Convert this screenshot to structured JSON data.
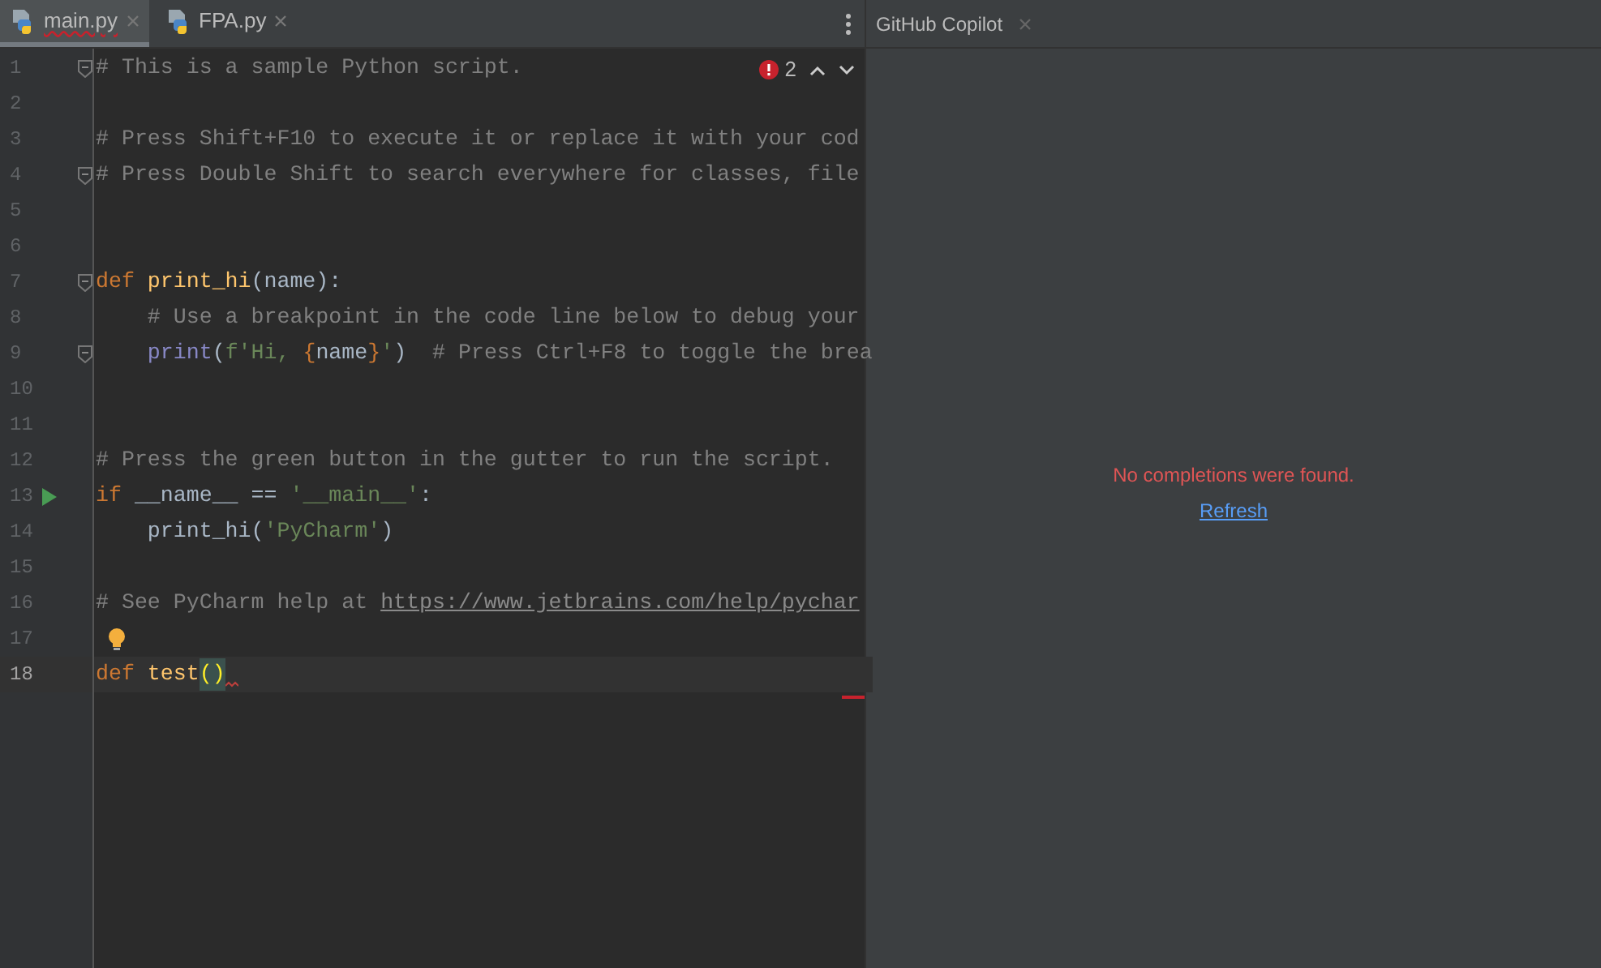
{
  "editor_tabs": [
    {
      "label": "main.py",
      "selected": true,
      "has_error": true
    },
    {
      "label": "FPA.py",
      "selected": false,
      "has_error": false
    }
  ],
  "inspection": {
    "error_count": "2"
  },
  "lines": [
    {
      "number": "1",
      "gutter_icon": {
        "kind": "fold"
      },
      "current": false,
      "error": false,
      "tokens": [
        {
          "kind": "comment",
          "text": "# This is a sample Python script."
        }
      ]
    },
    {
      "number": "2",
      "current": false,
      "error": false
    },
    {
      "number": "3",
      "current": false,
      "error": false,
      "tokens": [
        {
          "kind": "comment",
          "text": "# Press Shift+F10 to execute it or replace it with your cod"
        }
      ]
    },
    {
      "number": "4",
      "gutter_icon": {
        "kind": "fold"
      },
      "current": false,
      "error": false,
      "tokens": [
        {
          "kind": "comment",
          "text": "# Press Double Shift to search everywhere for classes, file"
        }
      ]
    },
    {
      "number": "5",
      "current": false,
      "error": false
    },
    {
      "number": "6",
      "current": false,
      "error": false
    },
    {
      "number": "7",
      "gutter_icon": {
        "kind": "fold"
      },
      "current": false,
      "error": false,
      "tokens": [
        {
          "kind": "keyword",
          "text": "def "
        },
        {
          "kind": "function",
          "text": "print_hi"
        },
        {
          "kind": "plain",
          "text": "(name):"
        }
      ]
    },
    {
      "number": "8",
      "current": false,
      "error": false,
      "tokens": [
        {
          "kind": "comment",
          "text": "    # Use a breakpoint in the code line below to debug your"
        }
      ]
    },
    {
      "number": "9",
      "gutter_icon": {
        "kind": "fold"
      },
      "current": false,
      "error": false,
      "tokens": [
        {
          "kind": "builtin",
          "text": "    print"
        },
        {
          "kind": "plain",
          "text": "("
        },
        {
          "kind": "string",
          "text": "f'Hi, "
        },
        {
          "kind": "brace",
          "text": "{"
        },
        {
          "kind": "plain",
          "text": "name"
        },
        {
          "kind": "brace",
          "text": "}"
        },
        {
          "kind": "string",
          "text": "'"
        },
        {
          "kind": "plain",
          "text": ")  "
        },
        {
          "kind": "comment",
          "text": "# Press Ctrl+F8 to toggle the brea"
        }
      ]
    },
    {
      "number": "10",
      "current": false,
      "error": false
    },
    {
      "number": "11",
      "current": false,
      "error": false
    },
    {
      "number": "12",
      "current": false,
      "error": false,
      "tokens": [
        {
          "kind": "comment",
          "text": "# Press the green button in the gutter to run the script."
        }
      ]
    },
    {
      "number": "13",
      "gutter_icon": {
        "kind": "run"
      },
      "current": false,
      "error": false,
      "tokens": [
        {
          "kind": "keyword",
          "text": "if "
        },
        {
          "kind": "plain",
          "text": "__name__ == "
        },
        {
          "kind": "string",
          "text": "'__main__'"
        },
        {
          "kind": "plain",
          "text": ":"
        }
      ]
    },
    {
      "number": "14",
      "current": false,
      "error": false,
      "tokens": [
        {
          "kind": "plain",
          "text": "    print_hi("
        },
        {
          "kind": "string",
          "text": "'PyCharm'"
        },
        {
          "kind": "plain",
          "text": ")"
        }
      ]
    },
    {
      "number": "15",
      "current": false,
      "error": false
    },
    {
      "number": "16",
      "current": false,
      "error": false,
      "tokens": [
        {
          "kind": "comment",
          "text": "# See PyCharm help at "
        },
        {
          "kind": "link",
          "text": "https://www.jetbrains.com/help/pychar"
        }
      ]
    },
    {
      "number": "17",
      "gutter_icon": {
        "kind": "bulb"
      },
      "current": false,
      "error": false
    },
    {
      "number": "18",
      "current": true,
      "error": true,
      "tokens": [
        {
          "kind": "keyword",
          "text": "def "
        },
        {
          "kind": "function",
          "text": "test"
        },
        {
          "kind": "brace_match",
          "text": "()"
        }
      ]
    }
  ],
  "side_panel": {
    "tabs": [
      {
        "label": "GitHub Copilot",
        "selected": true
      }
    ],
    "message": "No completions were found.",
    "action": "Refresh"
  }
}
